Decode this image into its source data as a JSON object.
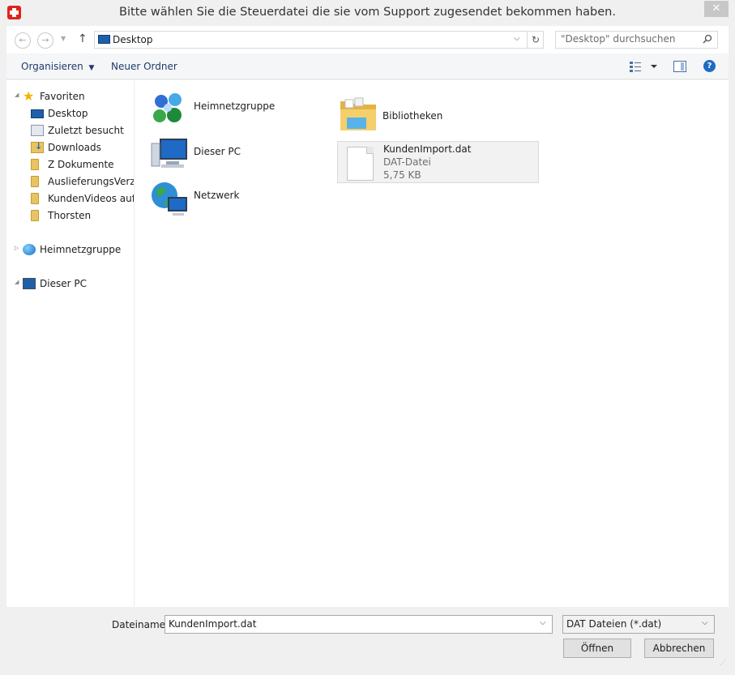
{
  "window": {
    "title": "Bitte wählen Sie die Steuerdatei die sie vom Support zugesendet bekommen haben.",
    "close_label": "✕",
    "accent_color": "#e0241b"
  },
  "navigation": {
    "back_icon": "back-arrow-icon",
    "forward_icon": "forward-arrow-icon",
    "up_icon": "up-arrow-icon",
    "address": "Desktop",
    "search_placeholder": "\"Desktop\" durchsuchen"
  },
  "toolbar": {
    "organize_label": "Organisieren",
    "new_folder_label": "Neuer Ordner"
  },
  "sidebar": {
    "favorites_label": "Favoriten",
    "favorites": [
      {
        "label": "Desktop"
      },
      {
        "label": "Zuletzt besucht"
      },
      {
        "label": "Downloads"
      },
      {
        "label": "Z Dokumente"
      },
      {
        "label": "AuslieferungsVerzeic"
      },
      {
        "label": "KundenVideos auf d"
      },
      {
        "label": "Thorsten"
      }
    ],
    "homegroup_label": "Heimnetzgruppe",
    "this_pc_label": "Dieser PC"
  },
  "content": {
    "items": [
      {
        "label": "Heimnetzgruppe",
        "icon": "homegroup-icon"
      },
      {
        "label": "Dieser PC",
        "icon": "computer-icon"
      },
      {
        "label": "Netzwerk",
        "icon": "network-icon"
      },
      {
        "label": "Bibliotheken",
        "icon": "libraries-folder-icon"
      }
    ],
    "file": {
      "name": "KundenImport.dat",
      "type": "DAT-Datei",
      "size": "5,75 KB"
    }
  },
  "footer": {
    "filename_label": "Dateiname:",
    "filename_value": "KundenImport.dat",
    "filetype_value": "DAT Dateien (*.dat)",
    "open_label": "Öffnen",
    "cancel_label": "Abbrechen"
  }
}
